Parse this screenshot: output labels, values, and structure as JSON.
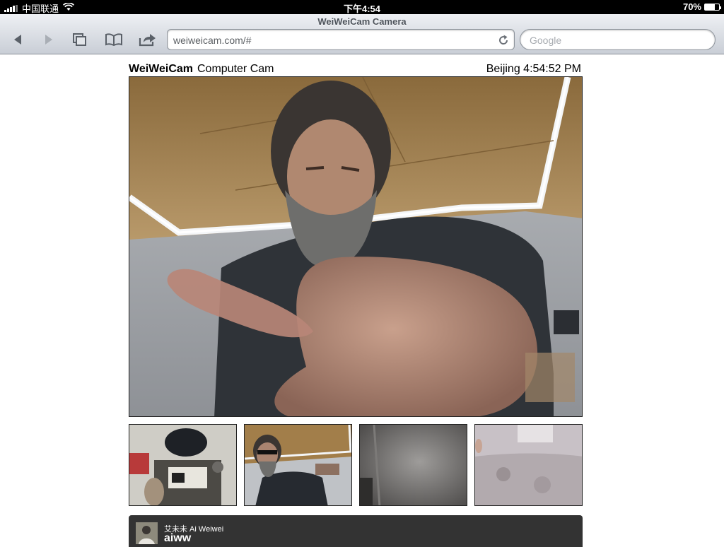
{
  "status_bar": {
    "carrier": "中国联通",
    "time": "下午4:54",
    "battery_percent": "70%",
    "battery_level": 0.7
  },
  "browser": {
    "page_title": "WeiWeiCam Camera",
    "url": "weiweicam.com/#",
    "search_placeholder": "Google",
    "icons": {
      "back": "back-arrow-icon",
      "forward": "forward-arrow-icon",
      "pages": "pages-icon",
      "bookmarks": "bookmarks-icon",
      "share": "share-icon",
      "reload": "reload-icon"
    }
  },
  "camera": {
    "brand": "WeiWeiCam",
    "camera_name": "Computer Cam",
    "clock": "Beijing 4:54:52 PM"
  },
  "thumbnails": [
    {
      "id": "overhead-desk"
    },
    {
      "id": "office-portrait"
    },
    {
      "id": "dark-wall"
    },
    {
      "id": "garden-view"
    }
  ],
  "twitter": {
    "display_name": "艾未未 Ai Weiwei",
    "handle": "aiww"
  },
  "colors": {
    "status_bar_bg": "#000000",
    "toolbar_top": "#eef0f4",
    "toolbar_bottom": "#c9ced6",
    "twitter_bar_bg": "#333333"
  }
}
